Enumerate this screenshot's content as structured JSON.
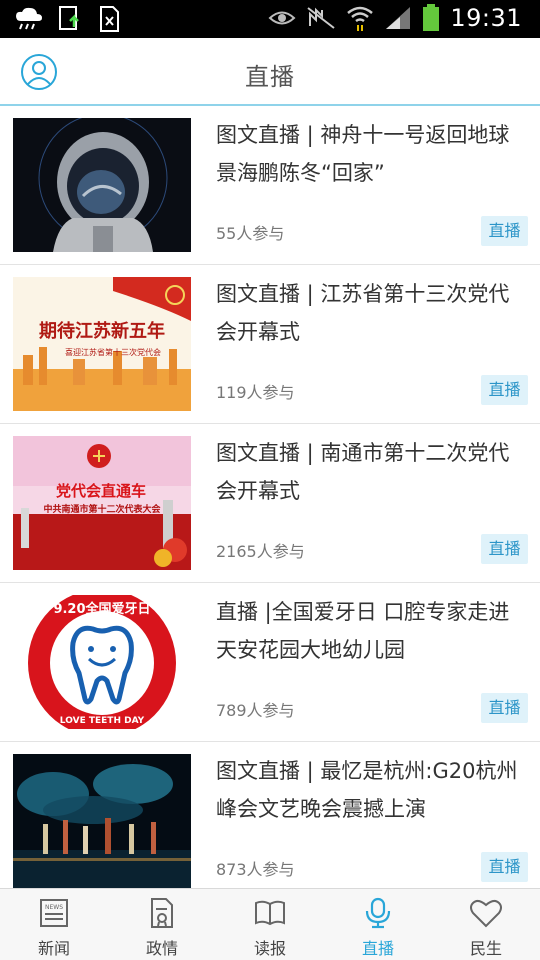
{
  "status_bar": {
    "time": "19:31"
  },
  "header": {
    "title": "直播",
    "accent": "#29a6d8"
  },
  "items": [
    {
      "title": "图文直播 | 神舟十一号返回地球 景海鹏陈冬“回家”",
      "count": "55人参与",
      "tag": "直播",
      "thumb_icon": "astronaut-image"
    },
    {
      "title": "图文直播 | 江苏省第十三次党代会开幕式",
      "count": "119人参与",
      "tag": "直播",
      "thumb_icon": "jiangsu-congress-poster",
      "thumb_text": "期待江苏新五年",
      "thumb_subtext": "喜迎江苏省第十三次党代会"
    },
    {
      "title": "图文直播 | 南通市第十二次党代会开幕式",
      "count": "2165人参与",
      "tag": "直播",
      "thumb_icon": "nantong-congress-poster",
      "thumb_text": "党代会直通车",
      "thumb_subtext": "中共南通市第十二次代表大会"
    },
    {
      "title": "直播 |全国爱牙日 口腔专家走进天安花园大地幼儿园",
      "count": "789人参与",
      "tag": "直播",
      "thumb_icon": "love-teeth-day-logo",
      "thumb_text": "9.20全国爱牙日",
      "thumb_subtext": "LOVE TEETH DAY"
    },
    {
      "title": "图文直播 | 最忆是杭州:G20杭州峰会文艺晚会震撼上演",
      "count": "873人参与",
      "tag": "直播",
      "thumb_icon": "g20-performance-photo"
    }
  ],
  "tabs": [
    {
      "label": "新闻",
      "icon": "newspaper-icon",
      "active": false
    },
    {
      "label": "政情",
      "icon": "document-icon",
      "active": false
    },
    {
      "label": "读报",
      "icon": "open-book-icon",
      "active": false
    },
    {
      "label": "直播",
      "icon": "microphone-icon",
      "active": true
    },
    {
      "label": "民生",
      "icon": "heart-icon",
      "active": false
    }
  ]
}
